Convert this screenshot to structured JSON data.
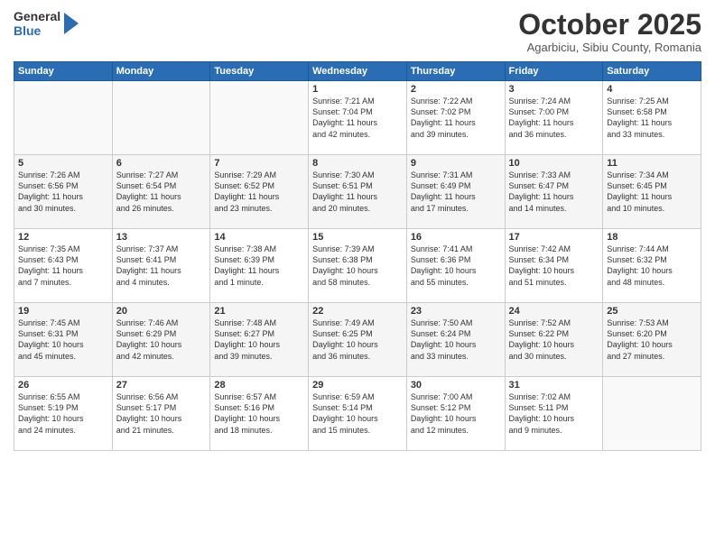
{
  "header": {
    "logo_general": "General",
    "logo_blue": "Blue",
    "month": "October 2025",
    "location": "Agarbiciu, Sibiu County, Romania"
  },
  "days_of_week": [
    "Sunday",
    "Monday",
    "Tuesday",
    "Wednesday",
    "Thursday",
    "Friday",
    "Saturday"
  ],
  "weeks": [
    [
      {
        "day": "",
        "info": ""
      },
      {
        "day": "",
        "info": ""
      },
      {
        "day": "",
        "info": ""
      },
      {
        "day": "1",
        "info": "Sunrise: 7:21 AM\nSunset: 7:04 PM\nDaylight: 11 hours\nand 42 minutes."
      },
      {
        "day": "2",
        "info": "Sunrise: 7:22 AM\nSunset: 7:02 PM\nDaylight: 11 hours\nand 39 minutes."
      },
      {
        "day": "3",
        "info": "Sunrise: 7:24 AM\nSunset: 7:00 PM\nDaylight: 11 hours\nand 36 minutes."
      },
      {
        "day": "4",
        "info": "Sunrise: 7:25 AM\nSunset: 6:58 PM\nDaylight: 11 hours\nand 33 minutes."
      }
    ],
    [
      {
        "day": "5",
        "info": "Sunrise: 7:26 AM\nSunset: 6:56 PM\nDaylight: 11 hours\nand 30 minutes."
      },
      {
        "day": "6",
        "info": "Sunrise: 7:27 AM\nSunset: 6:54 PM\nDaylight: 11 hours\nand 26 minutes."
      },
      {
        "day": "7",
        "info": "Sunrise: 7:29 AM\nSunset: 6:52 PM\nDaylight: 11 hours\nand 23 minutes."
      },
      {
        "day": "8",
        "info": "Sunrise: 7:30 AM\nSunset: 6:51 PM\nDaylight: 11 hours\nand 20 minutes."
      },
      {
        "day": "9",
        "info": "Sunrise: 7:31 AM\nSunset: 6:49 PM\nDaylight: 11 hours\nand 17 minutes."
      },
      {
        "day": "10",
        "info": "Sunrise: 7:33 AM\nSunset: 6:47 PM\nDaylight: 11 hours\nand 14 minutes."
      },
      {
        "day": "11",
        "info": "Sunrise: 7:34 AM\nSunset: 6:45 PM\nDaylight: 11 hours\nand 10 minutes."
      }
    ],
    [
      {
        "day": "12",
        "info": "Sunrise: 7:35 AM\nSunset: 6:43 PM\nDaylight: 11 hours\nand 7 minutes."
      },
      {
        "day": "13",
        "info": "Sunrise: 7:37 AM\nSunset: 6:41 PM\nDaylight: 11 hours\nand 4 minutes."
      },
      {
        "day": "14",
        "info": "Sunrise: 7:38 AM\nSunset: 6:39 PM\nDaylight: 11 hours\nand 1 minute."
      },
      {
        "day": "15",
        "info": "Sunrise: 7:39 AM\nSunset: 6:38 PM\nDaylight: 10 hours\nand 58 minutes."
      },
      {
        "day": "16",
        "info": "Sunrise: 7:41 AM\nSunset: 6:36 PM\nDaylight: 10 hours\nand 55 minutes."
      },
      {
        "day": "17",
        "info": "Sunrise: 7:42 AM\nSunset: 6:34 PM\nDaylight: 10 hours\nand 51 minutes."
      },
      {
        "day": "18",
        "info": "Sunrise: 7:44 AM\nSunset: 6:32 PM\nDaylight: 10 hours\nand 48 minutes."
      }
    ],
    [
      {
        "day": "19",
        "info": "Sunrise: 7:45 AM\nSunset: 6:31 PM\nDaylight: 10 hours\nand 45 minutes."
      },
      {
        "day": "20",
        "info": "Sunrise: 7:46 AM\nSunset: 6:29 PM\nDaylight: 10 hours\nand 42 minutes."
      },
      {
        "day": "21",
        "info": "Sunrise: 7:48 AM\nSunset: 6:27 PM\nDaylight: 10 hours\nand 39 minutes."
      },
      {
        "day": "22",
        "info": "Sunrise: 7:49 AM\nSunset: 6:25 PM\nDaylight: 10 hours\nand 36 minutes."
      },
      {
        "day": "23",
        "info": "Sunrise: 7:50 AM\nSunset: 6:24 PM\nDaylight: 10 hours\nand 33 minutes."
      },
      {
        "day": "24",
        "info": "Sunrise: 7:52 AM\nSunset: 6:22 PM\nDaylight: 10 hours\nand 30 minutes."
      },
      {
        "day": "25",
        "info": "Sunrise: 7:53 AM\nSunset: 6:20 PM\nDaylight: 10 hours\nand 27 minutes."
      }
    ],
    [
      {
        "day": "26",
        "info": "Sunrise: 6:55 AM\nSunset: 5:19 PM\nDaylight: 10 hours\nand 24 minutes."
      },
      {
        "day": "27",
        "info": "Sunrise: 6:56 AM\nSunset: 5:17 PM\nDaylight: 10 hours\nand 21 minutes."
      },
      {
        "day": "28",
        "info": "Sunrise: 6:57 AM\nSunset: 5:16 PM\nDaylight: 10 hours\nand 18 minutes."
      },
      {
        "day": "29",
        "info": "Sunrise: 6:59 AM\nSunset: 5:14 PM\nDaylight: 10 hours\nand 15 minutes."
      },
      {
        "day": "30",
        "info": "Sunrise: 7:00 AM\nSunset: 5:12 PM\nDaylight: 10 hours\nand 12 minutes."
      },
      {
        "day": "31",
        "info": "Sunrise: 7:02 AM\nSunset: 5:11 PM\nDaylight: 10 hours\nand 9 minutes."
      },
      {
        "day": "",
        "info": ""
      }
    ]
  ]
}
